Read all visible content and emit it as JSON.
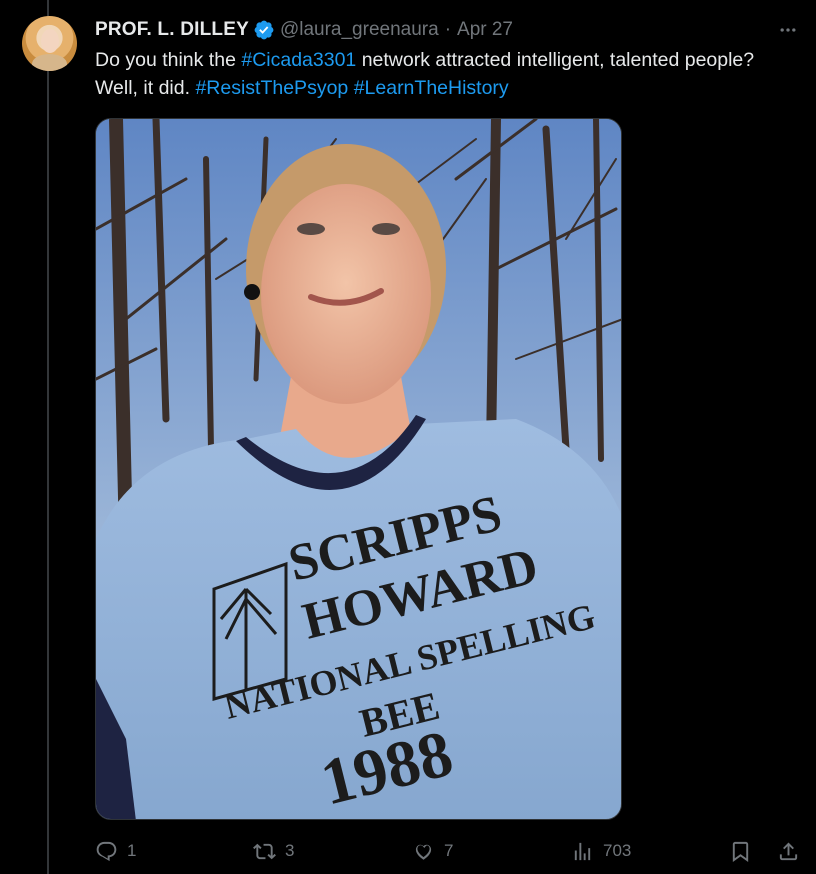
{
  "author": {
    "name": "PROF. L. DILLEY",
    "handle": "@laura_greenaura",
    "separator": "·",
    "date": "Apr 27"
  },
  "tweet": {
    "text_1": "Do you think the ",
    "tag_1": "#Cicada3301",
    "text_2": " network attracted intelligent, talented people? Well, it did. ",
    "tag_2": "#ResistThePsyop",
    "text_3": " ",
    "tag_3": "#LearnTheHistory"
  },
  "media": {
    "shirt_line_1": "SCRIPPS",
    "shirt_line_2": "HOWARD",
    "shirt_line_3": "NATIONAL SPELLING",
    "shirt_line_4": "BEE",
    "shirt_line_5": "1988"
  },
  "actions": {
    "replies": "1",
    "reposts": "3",
    "likes": "7",
    "views": "703"
  },
  "colors": {
    "background": "#000000",
    "text": "#e7e9ea",
    "secondary": "#71767b",
    "link": "#1d9bf0",
    "verified": "#1d9bf0"
  }
}
